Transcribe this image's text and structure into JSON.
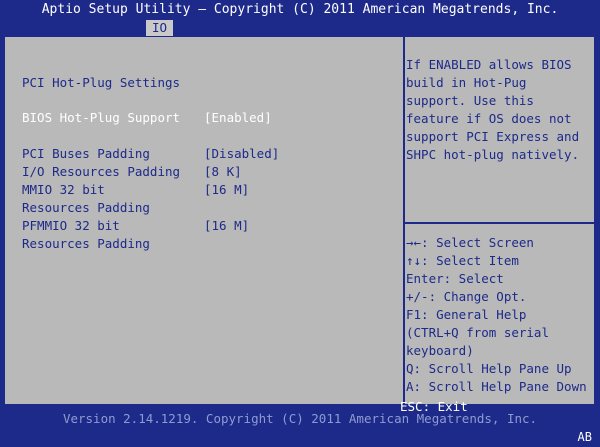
{
  "title": "Aptio Setup Utility – Copyright (C) 2011 American Megatrends, Inc.",
  "active_tab": "IO",
  "section_title": "PCI Hot-Plug Settings",
  "settings": [
    {
      "label": "BIOS Hot-Plug Support",
      "value": "[Enabled]",
      "selected": true
    },
    {
      "label": "PCI Buses Padding",
      "value": "[Disabled]"
    },
    {
      "label": "I/O Resources Padding",
      "value": "[8 K]"
    },
    {
      "label": "MMIO 32 bit",
      "label2": "Resources Padding",
      "value": "[16 M]"
    },
    {
      "label": "PFMMIO 32 bit",
      "label2": "Resources Padding",
      "value": "[16 M]"
    }
  ],
  "help_text": [
    "If ENABLED allows BIOS",
    "build in Hot-Pug",
    "support. Use this",
    "feature if OS does not",
    "support PCI Express and",
    "SHPC hot-plug natively."
  ],
  "key_help": [
    "→←: Select Screen",
    "↑↓: Select Item",
    "Enter: Select",
    "+/-: Change Opt.",
    "F1: General Help",
    "(CTRL+Q from serial",
    "keyboard)",
    "Q: Scroll Help Pane Up",
    "A: Scroll Help Pane Down",
    "ESC: Exit"
  ],
  "footer": "Version 2.14.1219. Copyright (C) 2011 American Megatrends, Inc.",
  "corner_label": "AB",
  "colors": {
    "background": "#1d2a8a",
    "panel": "#b9b9b9",
    "text_dark": "#1d2a8a",
    "text_highlight": "#ffffff"
  }
}
